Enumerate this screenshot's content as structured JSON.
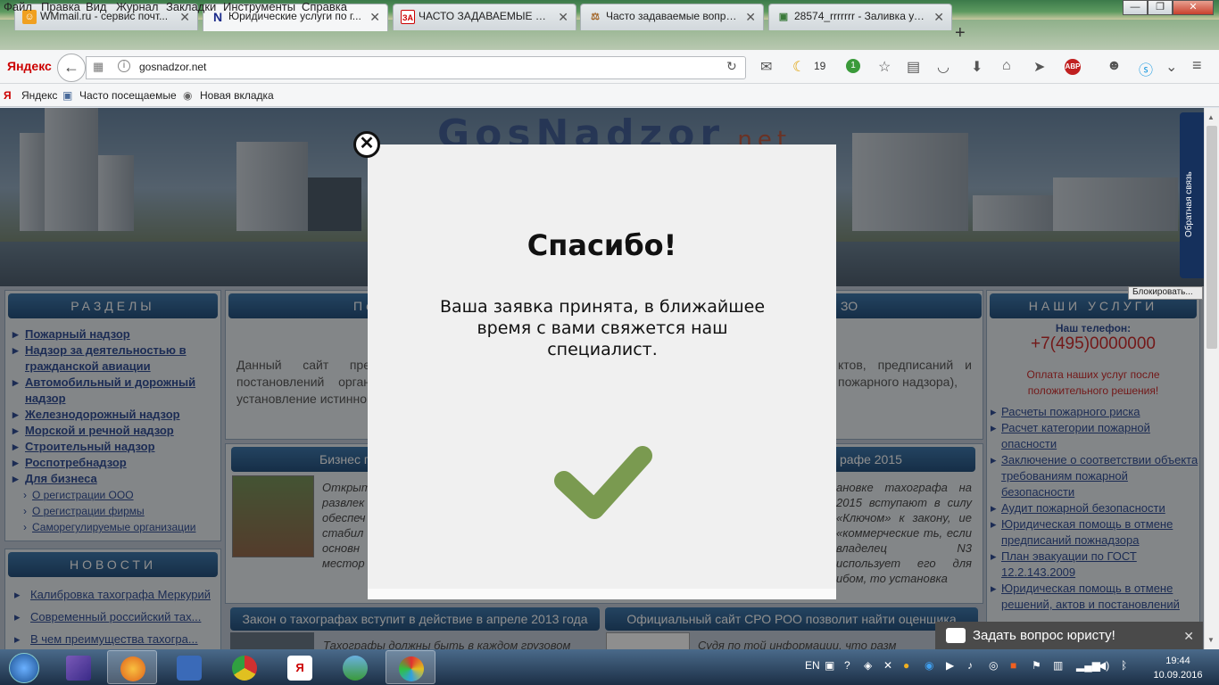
{
  "menu": [
    "Файл",
    "Правка",
    "Вид",
    "Журнал",
    "Закладки",
    "Инструменты",
    "Справка"
  ],
  "window_controls": {
    "minimize": "—",
    "maximize": "❐",
    "close": "✕"
  },
  "tabs": [
    {
      "title": "WMmail.ru - сервис почт...",
      "icon": "☺"
    },
    {
      "title": "Юридические услуги по г...",
      "icon": "N"
    },
    {
      "title": "ЧАСТО ЗАДАВАЕМЫЕ ВО...",
      "icon": "ЗА"
    },
    {
      "title": "Часто задаваемые вопрос...",
      "icon": "⚖"
    },
    {
      "title": "28574_rrrrrrr - Заливка уда...",
      "icon": "▣"
    }
  ],
  "newtab_label": "+",
  "navbar": {
    "yandex": "Яндекс",
    "url": "gosnadzor.net",
    "count_moon": "19",
    "count_green": "1"
  },
  "bookmarks": [
    "Яндекс",
    "Часто посещаемые",
    "Новая вкладка"
  ],
  "site": {
    "logo_main": "GosNadzor",
    "logo_suffix": ".net",
    "left_sections_title": "РАЗДЕЛЫ",
    "left_sections": [
      "Пожарный надзор",
      "Надзор за деятельностью в гражданской авиации",
      "Автомобильный и дорожный надзор",
      "Железнодорожный надзор",
      "Морской и речной надзор",
      "Строительный надзор",
      "Роспотребнадзор",
      "Для бизнеса"
    ],
    "left_subsections": [
      "О регистрации ООО",
      "О регистрации фирмы",
      "Саморегулируемые организации"
    ],
    "news_title": "НОВОСТИ",
    "news": [
      "Калибровка тахографа Меркурий",
      "Современный российский тах...",
      "В чем преимущества тахогра..."
    ],
    "mid_header_left": "По",
    "mid_header_right": "ЗО",
    "mid_text_left": "Данный сайт пре постановлений орган установление истинно",
    "mid_text_right": "ктов, предписаний и пожарного надзора),",
    "article1_header_left": "Бизнес п",
    "article1_header_right": "рафе 2015",
    "article1_text_left": "Открыт развлек обеспеч стабил основн местор",
    "article1_text_right": "ановке тахографа на 2015 вступают в силу «Ключом» к закону, ие «коммерческие ть, если владелец N3 использует его для ибом, то установка",
    "article2_header": "Закон о тахографах вступит в действие в апреле 2013 года",
    "article2_text": "Тахографы должны быть в каждом грузовом",
    "article3_header": "Официальный сайт СРО РОО позволит найти оценщика",
    "article3_text": "Судя по той информации, что разм",
    "services_title": "НАШИ УСЛУГИ",
    "phone_label": "Наш телефон:",
    "phone": "+7(495)0000000",
    "payment_note": "Оплата наших услуг после положительного решения!",
    "services": [
      "Расчеты пожарного риска",
      "Расчет категории пожарной опасности",
      "Заключение о соответствии объекта требованиям пожарной безопасности",
      "Аудит пожарной безопасности",
      "Юридическая помощь в отмене предписаний пожнадзора",
      "План эвакуации по ГОСТ 12.2.143.2009",
      "Юридическая помощь в отмене решений, актов и постановлений"
    ],
    "feedback_tab": "Обратная связь",
    "blocked": "Блокировать...",
    "ask_lawyer": "Задать вопрос юристу!",
    "ask_close": "✕"
  },
  "modal": {
    "title": "Спасибо!",
    "message": "Ваша заявка принята, в ближайшее время с вами свяжется наш специалист.",
    "close": "✕",
    "check_color": "#7a9a50"
  },
  "taskbar": {
    "lang": "EN",
    "time": "19:44",
    "date": "10.09.2016"
  },
  "colors": {
    "header_blue": "#0d3e70",
    "link": "#1a3b8a",
    "phone_red": "#c81414",
    "note_red": "#c81414"
  }
}
